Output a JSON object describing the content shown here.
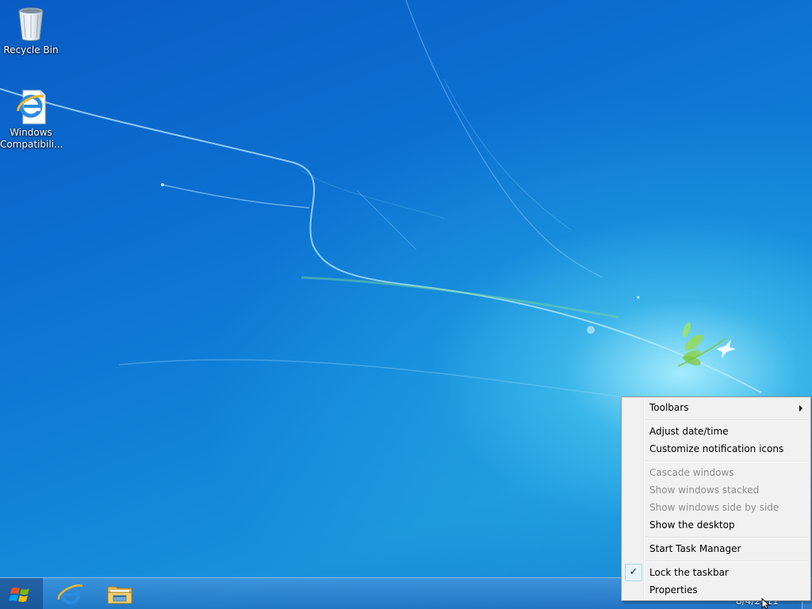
{
  "desktop": {
    "icons": [
      {
        "label": "Recycle Bin",
        "icon": "recycle-bin-icon"
      },
      {
        "label": "Windows Compatibili...",
        "label_line1": "Windows",
        "label_line2": "Compatibili...",
        "icon": "internet-explorer-shortcut-icon"
      }
    ]
  },
  "taskbar": {
    "start_icon": "windows-logo-icon",
    "pinned": [
      {
        "name": "Internet Explorer",
        "icon": "internet-explorer-icon"
      },
      {
        "name": "Windows Explorer",
        "icon": "folder-explorer-icon"
      }
    ],
    "clock": {
      "date": "8/4/2011"
    }
  },
  "context_menu": {
    "items": [
      {
        "label": "Toolbars",
        "has_submenu": true,
        "enabled": true
      },
      {
        "label": "Adjust date/time",
        "enabled": true
      },
      {
        "label": "Customize notification icons",
        "enabled": true
      },
      {
        "label": "Cascade windows",
        "enabled": false
      },
      {
        "label": "Show windows stacked",
        "enabled": false
      },
      {
        "label": "Show windows side by side",
        "enabled": false
      },
      {
        "label": "Show the desktop",
        "enabled": true
      },
      {
        "label": "Start Task Manager",
        "enabled": true
      },
      {
        "label": "Lock the taskbar",
        "enabled": true,
        "checked": true,
        "check_glyph": "✓"
      },
      {
        "label": "Properties",
        "enabled": true
      }
    ]
  },
  "colors": {
    "menu_background": "#f1f1f1",
    "disabled_text": "#8d8d8d",
    "wallpaper_blue": "#0c6fd0"
  }
}
